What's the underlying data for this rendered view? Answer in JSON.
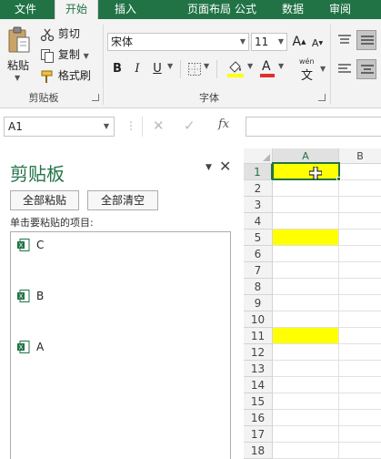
{
  "tabs": [
    "文件",
    "开始",
    "插入",
    "页面布局",
    "公式",
    "数据",
    "审阅"
  ],
  "active_tab_index": 1,
  "clipboard_group": {
    "paste_label": "粘贴",
    "cut_label": "剪切",
    "copy_label": "复制",
    "format_painter_label": "格式刷",
    "group_label": "剪贴板"
  },
  "font_group": {
    "font_name": "宋体",
    "font_size": "11",
    "grow_label": "A",
    "shrink_label": "A",
    "bold": "B",
    "italic": "I",
    "underline": "U",
    "wen_label": "wén",
    "wen_char": "文",
    "font_color_label": "A",
    "group_label": "字体",
    "fill_color": "#ffff00",
    "font_color": "#e03030"
  },
  "formula_bar": {
    "name_box": "A1",
    "fx_label": "fx",
    "formula_value": ""
  },
  "pane": {
    "title": "剪贴板",
    "paste_all": "全部粘贴",
    "clear_all": "全部清空",
    "hint": "单击要粘贴的项目:",
    "items": [
      "C",
      "B",
      "A"
    ]
  },
  "sheet": {
    "columns": [
      "A",
      "B"
    ],
    "rows": [
      "1",
      "2",
      "3",
      "4",
      "5",
      "6",
      "7",
      "8",
      "9",
      "10",
      "11",
      "12",
      "13",
      "14",
      "15",
      "16",
      "17",
      "18"
    ],
    "highlighted_rows": [
      1,
      5,
      11
    ],
    "highlight_color": "#ffff00",
    "selected_cell": "A1",
    "accent": "#217346"
  }
}
